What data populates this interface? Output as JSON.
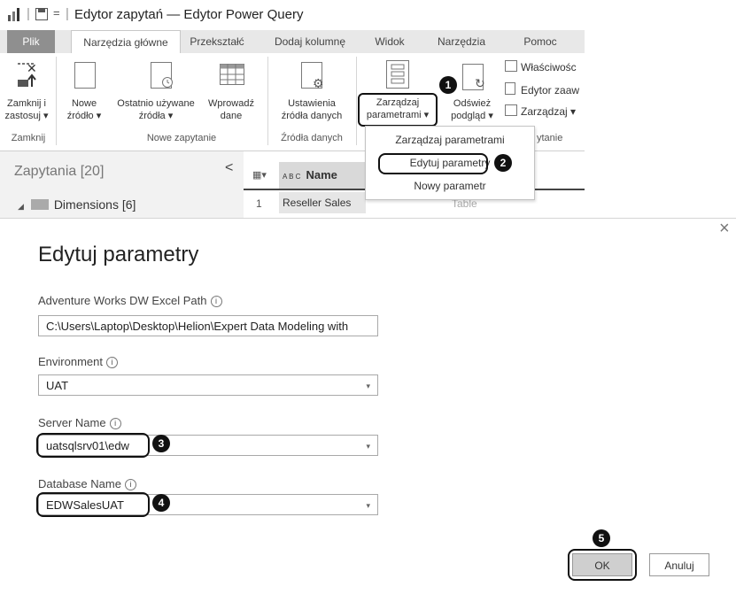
{
  "window": {
    "title": "Edytor zapytań — Edytor Power Query"
  },
  "tabs": [
    {
      "label": "Plik"
    },
    {
      "label": "Narzędzia główne"
    },
    {
      "label": "Przekształć"
    },
    {
      "label": "Dodaj kolumnę"
    },
    {
      "label": "Widok"
    },
    {
      "label": "Narzędzia"
    },
    {
      "label": "Pomoc"
    }
  ],
  "ribbon": {
    "close_apply": {
      "line1": "Zamknij i",
      "line2": "zastosuj ▾"
    },
    "new_source": {
      "line1": "Nowe",
      "line2": "źródło ▾"
    },
    "recent_sources": {
      "line1": "Ostatnio używane",
      "line2": "źródła ▾"
    },
    "enter_data": {
      "line1": "Wprowadź",
      "line2": "dane"
    },
    "source_settings": {
      "line1": "Ustawienia",
      "line2": "źródła danych"
    },
    "manage_params": {
      "line1": "Zarządzaj",
      "line2": "parametrami ▾"
    },
    "refresh_preview": {
      "line1": "Odśwież",
      "line2": "podgląd ▾"
    },
    "properties": "Właściwośc",
    "advanced_editor": "Edytor zaaw",
    "manage": "Zarządzaj ▾",
    "groups": {
      "close": "Zamknij",
      "new_query": "Nowe zapytanie",
      "data_sources": "Źródła danych",
      "query": "ytanie"
    }
  },
  "dropdown": {
    "items": [
      "Zarządzaj parametrami",
      "Edytuj parametry",
      "Nowy parametr"
    ]
  },
  "queries": {
    "header": "Zapytania [20]",
    "collapse_glyph": "<",
    "folder": "Dimensions [6]"
  },
  "grid": {
    "column_header": "Name",
    "type_glyph": "A B C",
    "row_num": "1",
    "row_value": "Reseller Sales",
    "row_type": "Table"
  },
  "dialog": {
    "title": "Edytuj parametry",
    "close_glyph": "×",
    "fields": [
      {
        "label": "Adventure Works DW Excel Path",
        "value": "C:\\Users\\Laptop\\Desktop\\Helion\\Expert Data Modeling with"
      },
      {
        "label": "Environment",
        "value": "UAT"
      },
      {
        "label": "Server Name",
        "value": "uatsqlsrv01\\edw"
      },
      {
        "label": "Database Name",
        "value": "EDWSalesUAT"
      }
    ],
    "ok_label": "OK",
    "cancel_label": "Anuluj"
  },
  "callouts": [
    "1",
    "2",
    "3",
    "4",
    "5"
  ],
  "info_glyph": "i"
}
